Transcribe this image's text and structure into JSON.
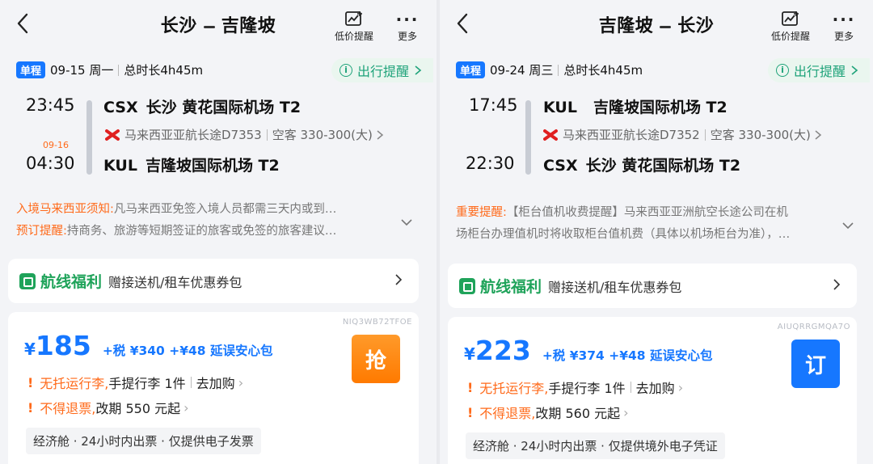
{
  "panels": [
    {
      "title_from": "长沙",
      "title_to": "吉隆坡",
      "price_alert_label": "低价提醒",
      "more_label": "更多",
      "trip_tag": "单程",
      "date": "09-15 周一",
      "duration": "总时长4h45m",
      "reminder_label": "出行提醒",
      "dep_time": "23:45",
      "arr_time": "04:30",
      "arr_date": "09-16",
      "dep_code": "CSX",
      "dep_airport": "长沙 黄花国际机场 T2",
      "arr_code": "KUL",
      "arr_airport": "吉隆坡国际机场 T2",
      "airline": "马来西亚亚航长途D7353",
      "aircraft": "空客 330-300(大)",
      "notices": [
        {
          "key": "入境马来西亚须知:",
          "text": "凡马来西亚免签入境人员都需三天内或到…"
        },
        {
          "key": "预订提醒:",
          "text": "持商务、旅游等短期签证的旅客或免签的旅客建议…"
        }
      ],
      "benefit_title": "航线福利",
      "benefit_desc": "赠接送机/租车优惠券包",
      "product_id": "NIQ3WB72TFOE",
      "currency": "¥",
      "price": "185",
      "tax": "+税 ¥340 +¥48 延误安心包",
      "book_label": "抢",
      "book_color": "#ff8a10",
      "baggage_warn": "无托运行李,",
      "baggage_rest": "手提行李 1件",
      "baggage_action": "去加购",
      "refund_warn": "不得退票,",
      "refund_rest": "改期 550 元起",
      "cabin_info": "经济舱 · 24小时内出票 · 仅提供电子发票"
    },
    {
      "title_from": "吉隆坡",
      "title_to": "长沙",
      "price_alert_label": "低价提醒",
      "more_label": "更多",
      "trip_tag": "单程",
      "date": "09-24 周三",
      "duration": "总时长4h45m",
      "reminder_label": "出行提醒",
      "dep_time": "17:45",
      "arr_time": "22:30",
      "arr_date": "",
      "dep_code": "KUL",
      "dep_airport": "吉隆坡国际机场 T2",
      "arr_code": "CSX",
      "arr_airport": "长沙 黄花国际机场 T2",
      "airline": "马来西亚亚航长途D7352",
      "aircraft": "空客 330-300(大)",
      "notices": [
        {
          "key": "重要提醒:",
          "text": "【柜台值机收费提醒】马来西亚亚洲航空长途公司在机"
        },
        {
          "key": "",
          "text": "场柜台办理值机时将收取柜台值机费（具体以机场柜台为准），…"
        }
      ],
      "benefit_title": "航线福利",
      "benefit_desc": "赠接送机/租车优惠券包",
      "product_id": "AIUQRRGMQA7O",
      "currency": "¥",
      "price": "223",
      "tax": "+税 ¥374 +¥48 延误安心包",
      "book_label": "订",
      "book_color": "#1677ff",
      "baggage_warn": "无托运行李,",
      "baggage_rest": "手提行李 1件",
      "baggage_action": "去加购",
      "refund_warn": "不得退票,",
      "refund_rest": "改期 560 元起",
      "cabin_info": "经济舱 · 24小时内出票 · 仅提供境外电子凭证"
    }
  ]
}
